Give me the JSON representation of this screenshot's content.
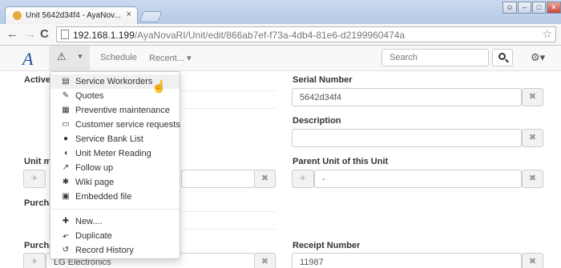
{
  "browser": {
    "tab_title": "Unit 5642d34f4 - AyaNov...",
    "tab_close": "×",
    "url_host": "192.168.1.199",
    "url_path": "/AyaNovaRI/Unit/edit/866ab7ef-f73a-4db4-81e6-d2199960474a",
    "back_glyph": "←",
    "forward_glyph": "→",
    "reload_glyph": "C",
    "star_glyph": "☆"
  },
  "navbar": {
    "logo": "A",
    "warn_glyph": "⚠",
    "caret": "▼",
    "schedule": "Schedule",
    "recent": "Recent... ▾",
    "search_placeholder": "Search",
    "gear_glyph": "⚙▾"
  },
  "menu": {
    "items": [
      {
        "label": "Service Workorders",
        "icon": "workorder-icon",
        "glyph": "▤"
      },
      {
        "label": "Quotes",
        "icon": "quote-icon",
        "glyph": "✎"
      },
      {
        "label": "Preventive maintenance",
        "icon": "preventive-icon",
        "glyph": "▦"
      },
      {
        "label": "Customer service requests",
        "icon": "laptop-icon",
        "glyph": "▭"
      },
      {
        "label": "Service Bank List",
        "icon": "piggy-bank-icon",
        "glyph": "●"
      },
      {
        "label": "Unit Meter Reading",
        "icon": "meter-icon",
        "glyph": "◖"
      },
      {
        "label": "Follow up",
        "icon": "follow-up-icon",
        "glyph": "↗"
      },
      {
        "label": "Wiki page",
        "icon": "wiki-icon",
        "glyph": "✱"
      },
      {
        "label": "Embedded file",
        "icon": "file-icon",
        "glyph": "▣"
      },
      {
        "label": "New....",
        "icon": "plus-icon",
        "glyph": "✚"
      },
      {
        "label": "Duplicate",
        "icon": "duplicate-icon",
        "glyph": "⬐"
      },
      {
        "label": "Record History",
        "icon": "history-icon",
        "glyph": "↺"
      }
    ]
  },
  "form": {
    "active_label": "Active",
    "unit_model_label": "Unit m",
    "purchased_label": "Purcha",
    "purchased_from_label": "Purcha",
    "purchased_from_value": "LG Electronics",
    "serial_label": "Serial Number",
    "serial_value": "5642d34f4",
    "description_label": "Description",
    "description_value": "",
    "parent_label": "Parent Unit of this Unit",
    "parent_value": "-",
    "receipt_label": "Receipt Number",
    "receipt_value": "11987",
    "clear_glyph": "✖",
    "pick_glyph": "✈"
  },
  "colors": {
    "logo": "#1b4e9b",
    "chrome": "#c9d9ef"
  }
}
